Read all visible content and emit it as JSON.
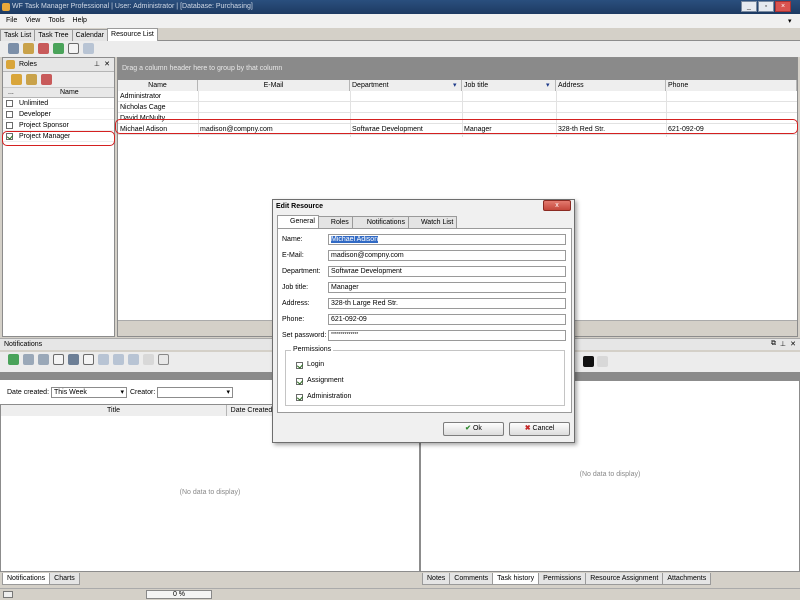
{
  "window": {
    "title": "WF Task Manager Professional | User: Administrator | [Database: Purchasing]"
  },
  "menu": [
    "File",
    "View",
    "Tools",
    "Help"
  ],
  "main_tabs": [
    "Task List",
    "Task Tree",
    "Calendar",
    "Resource List"
  ],
  "roles": {
    "title": "Roles",
    "col_ellipsis": "...",
    "col_name": "Name",
    "items": [
      {
        "label": "Unlimited",
        "checked": false
      },
      {
        "label": "Developer",
        "checked": false
      },
      {
        "label": "Project Sponsor",
        "checked": false
      },
      {
        "label": "Project Manager",
        "checked": true
      }
    ]
  },
  "resources": {
    "group_hint": "Drag a column header here to group by that column",
    "columns": [
      "Name",
      "E-Mail",
      "Department",
      "Job title",
      "Address",
      "Phone"
    ],
    "rows": [
      [
        "Administrator",
        "",
        "",
        "",
        "",
        ""
      ],
      [
        "Nicholas Cage",
        "",
        "",
        "",
        "",
        ""
      ],
      [
        "David McNulty",
        "",
        "",
        "",
        "",
        ""
      ],
      [
        "Michael Adison",
        "madison@compny.com",
        "Softwrae Development",
        "Manager",
        "328-th Red Str.",
        "621-092-09"
      ]
    ]
  },
  "notifications": {
    "title": "Notifications",
    "date_label": "Date created:",
    "date_value": "This Week",
    "creator_label": "Creator:",
    "creator_value": "",
    "col_title": "Title",
    "col_date": "Date Created",
    "empty": "(No data to display)",
    "bottom_tabs": [
      "Notifications",
      "Charts"
    ]
  },
  "right_panel": {
    "empty": "(No data to display)",
    "bottom_tabs": [
      "Notes",
      "Comments",
      "Task history",
      "Permissions",
      "Resource Assignment",
      "Attachments"
    ]
  },
  "dialog": {
    "title": "Edit Resource",
    "close": "x",
    "tabs": [
      "General",
      "Roles",
      "Notifications",
      "Watch List"
    ],
    "fields": [
      {
        "label": "Name:",
        "value": "Michael Adison"
      },
      {
        "label": "E-Mail:",
        "value": "madison@compny.com"
      },
      {
        "label": "Department:",
        "value": "Softwrae Development"
      },
      {
        "label": "Job title:",
        "value": "Manager"
      },
      {
        "label": "Address:",
        "value": "328-th Large Red Str."
      },
      {
        "label": "Phone:",
        "value": "621-092-09"
      },
      {
        "label": "Set password:",
        "value": "**************"
      }
    ],
    "permissions_title": "Permissions",
    "permissions": [
      {
        "label": "Login",
        "checked": true
      },
      {
        "label": "Assignment",
        "checked": true
      },
      {
        "label": "Administration",
        "checked": true
      }
    ],
    "ok": "Ok",
    "cancel": "Cancel"
  },
  "status": {
    "progress_text": "0 %",
    "progress": 0
  }
}
